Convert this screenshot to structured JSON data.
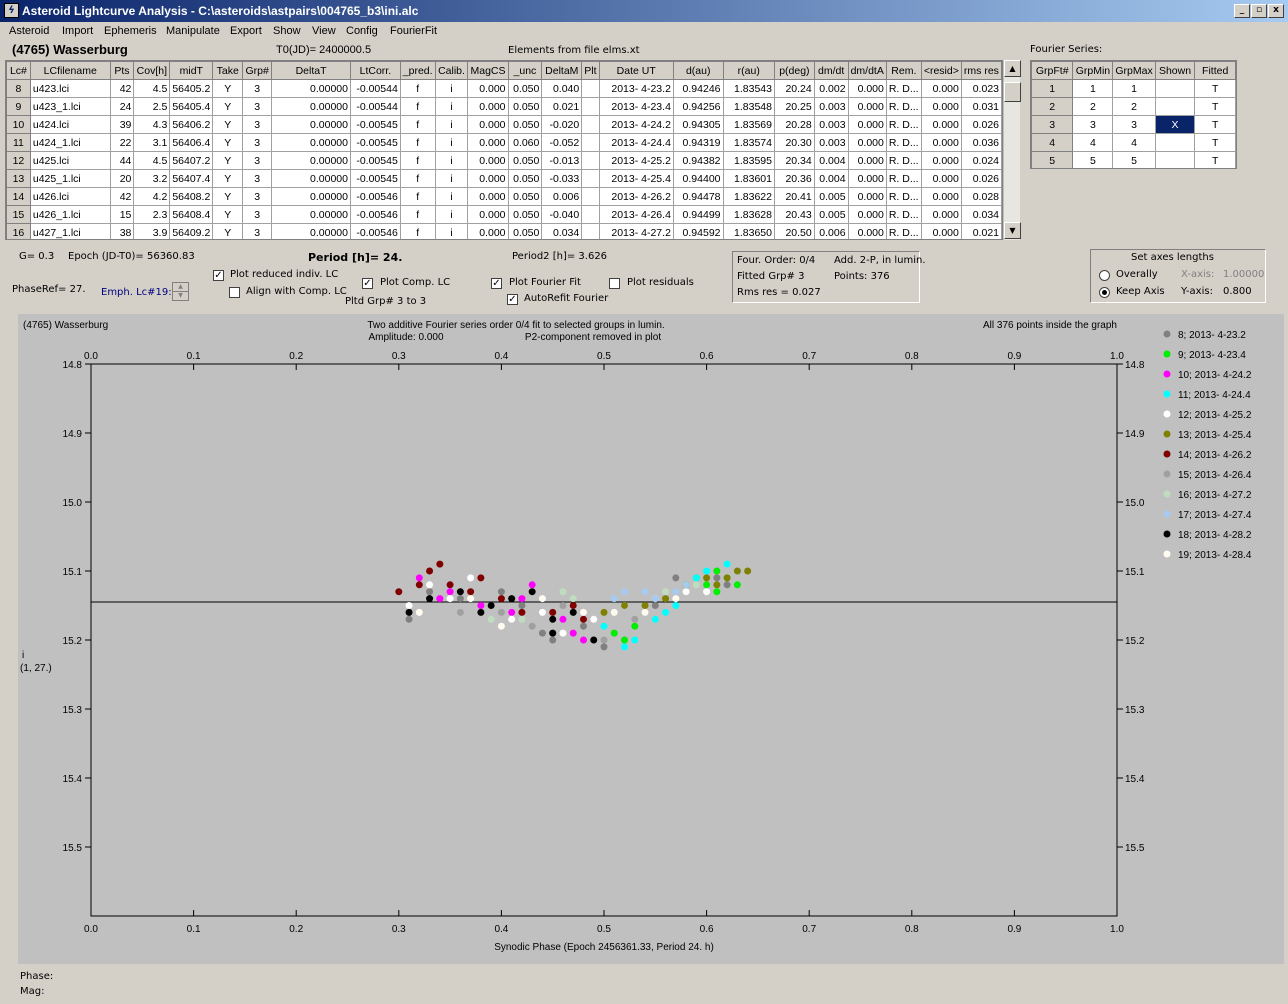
{
  "window": {
    "title": "Asteroid Lightcurve Analysis - C:\\asteroids\\astpairs\\004765_b3\\ini.alc",
    "icon": "app-icon"
  },
  "menu": [
    "Asteroid",
    "Import",
    "Ephemeris",
    "Manipulate",
    "Export",
    "Show",
    "View",
    "Config",
    "FourierFit"
  ],
  "header": {
    "asteroid": "(4765) Wasserburg",
    "t0": "T0(JD)= 2400000.5",
    "elements": "Elements from file elms.xt",
    "fourier_label": "Fourier Series:"
  },
  "lc_table": {
    "columns": [
      "Lc#",
      "LCfilename",
      "Pts",
      "Cov[h]",
      "midT",
      "Take",
      "Grp#",
      "DeltaT",
      "LtCorr.",
      "_pred.",
      "Calib.",
      "MagCS",
      "_unc",
      "DeltaM",
      "Plt",
      "Date UT",
      "d(au)",
      "r(au)",
      "p(deg)",
      "dm/dt",
      "dm/dtA",
      "Rem.",
      "<resid>",
      "rms res"
    ],
    "rows": [
      [
        "8",
        "u423.lci",
        "42",
        "4.5",
        "56405.2",
        "Y",
        "3",
        "0.00000",
        "-0.00544",
        "f",
        "i",
        "0.000",
        "0.050",
        "0.040",
        "",
        "2013- 4-23.2",
        "0.94246",
        "1.83543",
        "20.24",
        "0.002",
        "0.000",
        "R. D...",
        "0.000",
        "0.023"
      ],
      [
        "9",
        "u423_1.lci",
        "24",
        "2.5",
        "56405.4",
        "Y",
        "3",
        "0.00000",
        "-0.00544",
        "f",
        "i",
        "0.000",
        "0.050",
        "0.021",
        "",
        "2013- 4-23.4",
        "0.94256",
        "1.83548",
        "20.25",
        "0.003",
        "0.000",
        "R. D...",
        "0.000",
        "0.031"
      ],
      [
        "10",
        "u424.lci",
        "39",
        "4.3",
        "56406.2",
        "Y",
        "3",
        "0.00000",
        "-0.00545",
        "f",
        "i",
        "0.000",
        "0.050",
        "-0.020",
        "",
        "2013- 4-24.2",
        "0.94305",
        "1.83569",
        "20.28",
        "0.003",
        "0.000",
        "R. D...",
        "0.000",
        "0.026"
      ],
      [
        "11",
        "u424_1.lci",
        "22",
        "3.1",
        "56406.4",
        "Y",
        "3",
        "0.00000",
        "-0.00545",
        "f",
        "i",
        "0.000",
        "0.060",
        "-0.052",
        "",
        "2013- 4-24.4",
        "0.94319",
        "1.83574",
        "20.30",
        "0.003",
        "0.000",
        "R. D...",
        "0.000",
        "0.036"
      ],
      [
        "12",
        "u425.lci",
        "44",
        "4.5",
        "56407.2",
        "Y",
        "3",
        "0.00000",
        "-0.00545",
        "f",
        "i",
        "0.000",
        "0.050",
        "-0.013",
        "",
        "2013- 4-25.2",
        "0.94382",
        "1.83595",
        "20.34",
        "0.004",
        "0.000",
        "R. D...",
        "0.000",
        "0.024"
      ],
      [
        "13",
        "u425_1.lci",
        "20",
        "3.2",
        "56407.4",
        "Y",
        "3",
        "0.00000",
        "-0.00545",
        "f",
        "i",
        "0.000",
        "0.050",
        "-0.033",
        "",
        "2013- 4-25.4",
        "0.94400",
        "1.83601",
        "20.36",
        "0.004",
        "0.000",
        "R. D...",
        "0.000",
        "0.026"
      ],
      [
        "14",
        "u426.lci",
        "42",
        "4.2",
        "56408.2",
        "Y",
        "3",
        "0.00000",
        "-0.00546",
        "f",
        "i",
        "0.000",
        "0.050",
        "0.006",
        "",
        "2013- 4-26.2",
        "0.94478",
        "1.83622",
        "20.41",
        "0.005",
        "0.000",
        "R. D...",
        "0.000",
        "0.028"
      ],
      [
        "15",
        "u426_1.lci",
        "15",
        "2.3",
        "56408.4",
        "Y",
        "3",
        "0.00000",
        "-0.00546",
        "f",
        "i",
        "0.000",
        "0.050",
        "-0.040",
        "",
        "2013- 4-26.4",
        "0.94499",
        "1.83628",
        "20.43",
        "0.005",
        "0.000",
        "R. D...",
        "0.000",
        "0.034"
      ],
      [
        "16",
        "u427_1.lci",
        "38",
        "3.9",
        "56409.2",
        "Y",
        "3",
        "0.00000",
        "-0.00546",
        "f",
        "i",
        "0.000",
        "0.050",
        "0.034",
        "",
        "2013- 4-27.2",
        "0.94592",
        "1.83650",
        "20.50",
        "0.006",
        "0.000",
        "R. D...",
        "0.000",
        "0.021"
      ]
    ]
  },
  "fourier_table": {
    "columns": [
      "GrpFt#",
      "GrpMin",
      "GrpMax",
      "Shown",
      "Fitted"
    ],
    "rows": [
      [
        "1",
        "1",
        "1",
        "",
        "T"
      ],
      [
        "2",
        "2",
        "2",
        "",
        "T"
      ],
      [
        "3",
        "3",
        "3",
        "X",
        "T"
      ],
      [
        "4",
        "4",
        "4",
        "",
        "T"
      ],
      [
        "5",
        "5",
        "5",
        "",
        "T"
      ]
    ]
  },
  "controls": {
    "g": "G= 0.3",
    "epoch": "Epoch (JD-T0)= 56360.83",
    "period": "Period [h]= 24.",
    "period2": "Period2 [h]= 3.626",
    "phaseref": "PhaseRef= 27.",
    "emph": "Emph. Lc#19:",
    "plot_reduced": "Plot reduced indiv. LC",
    "align_comp": "Align with Comp. LC",
    "plot_comp": "Plot Comp. LC",
    "pltd_grp": "Pltd Grp#  3  to   3",
    "plot_fourier": "Plot Fourier Fit",
    "autorefit": "AutoRefit Fourier",
    "plot_residuals": "Plot residuals",
    "info_order": "Four. Order:  0/4",
    "info_fitted": "Fitted Grp# 3",
    "info_rms": "Rms res    = 0.027",
    "info_add": "Add. 2-P, in lumin.",
    "info_points": "Points: 376",
    "axes_title": "Set axes lengths",
    "overally": "Overally",
    "keep_axis": "Keep Axis",
    "xaxis_label": "X-axis:",
    "xaxis_val": "1.00000",
    "yaxis_label": "Y-axis:",
    "yaxis_val": "0.800"
  },
  "status": {
    "phase": "Phase:",
    "mag": "Mag:"
  },
  "chart_data": {
    "type": "scatter",
    "title": "(4765) Wasserburg",
    "subtitle": "Two additive Fourier series order 0/4 fit to selected groups in lumin.",
    "amplitude": "Amplitude: 0.000",
    "p2note": "P2-component removed in plot",
    "note_right": "All 376 points inside the graph",
    "xlabel": "Synodic Phase (Epoch 2456361.33, Period 24. h)",
    "ylabel": "i",
    "ylabel2": "(1, 27.)",
    "xlim": [
      0.0,
      1.0
    ],
    "ylim": [
      14.8,
      15.6
    ],
    "y_inverted": true,
    "fit_line_y": 15.145,
    "x_ticks": [
      "0.0",
      "0.1",
      "0.2",
      "0.3",
      "0.4",
      "0.5",
      "0.6",
      "0.7",
      "0.8",
      "0.9",
      "1.0"
    ],
    "y_ticks": [
      "14.8",
      "14.9",
      "15.0",
      "15.1",
      "15.2",
      "15.3",
      "15.4",
      "15.5"
    ],
    "legend": [
      {
        "label": "8; 2013- 4-23.2",
        "color": "#808080"
      },
      {
        "label": "9; 2013- 4-23.4",
        "color": "#00ee00"
      },
      {
        "label": "10; 2013- 4-24.2",
        "color": "#ff00ff"
      },
      {
        "label": "11; 2013- 4-24.4",
        "color": "#00ffff"
      },
      {
        "label": "12; 2013- 4-25.2",
        "color": "#ffffff"
      },
      {
        "label": "13; 2013- 4-25.4",
        "color": "#808000"
      },
      {
        "label": "14; 2013- 4-26.2",
        "color": "#800000"
      },
      {
        "label": "15; 2013- 4-26.4",
        "color": "#a0a0a0"
      },
      {
        "label": "16; 2013- 4-27.2",
        "color": "#c0dcc0"
      },
      {
        "label": "17; 2013- 4-27.4",
        "color": "#a6caf0"
      },
      {
        "label": "18; 2013- 4-28.2",
        "color": "#000000"
      },
      {
        "label": "19; 2013- 4-28.4",
        "color": "#fffbf0"
      }
    ],
    "series": [
      {
        "color": "#808080",
        "points": [
          [
            0.31,
            15.17
          ],
          [
            0.33,
            15.13
          ],
          [
            0.36,
            15.14
          ],
          [
            0.4,
            15.13
          ],
          [
            0.42,
            15.15
          ],
          [
            0.44,
            15.19
          ],
          [
            0.45,
            15.2
          ],
          [
            0.48,
            15.18
          ],
          [
            0.5,
            15.21
          ],
          [
            0.55,
            15.15
          ],
          [
            0.57,
            15.11
          ],
          [
            0.61,
            15.11
          ],
          [
            0.62,
            15.12
          ]
        ]
      },
      {
        "color": "#00ee00",
        "points": [
          [
            0.51,
            15.19
          ],
          [
            0.52,
            15.2
          ],
          [
            0.53,
            15.18
          ],
          [
            0.58,
            15.12
          ],
          [
            0.59,
            15.11
          ],
          [
            0.6,
            15.12
          ],
          [
            0.61,
            15.13
          ],
          [
            0.62,
            15.11
          ],
          [
            0.63,
            15.12
          ],
          [
            0.61,
            15.1
          ]
        ]
      },
      {
        "color": "#ff00ff",
        "points": [
          [
            0.32,
            15.11
          ],
          [
            0.34,
            15.14
          ],
          [
            0.38,
            15.15
          ],
          [
            0.41,
            15.16
          ],
          [
            0.42,
            15.14
          ],
          [
            0.43,
            15.12
          ],
          [
            0.46,
            15.17
          ],
          [
            0.47,
            15.19
          ],
          [
            0.48,
            15.2
          ],
          [
            0.35,
            15.13
          ]
        ]
      },
      {
        "color": "#00ffff",
        "points": [
          [
            0.5,
            15.18
          ],
          [
            0.52,
            15.21
          ],
          [
            0.53,
            15.2
          ],
          [
            0.55,
            15.17
          ],
          [
            0.57,
            15.15
          ],
          [
            0.59,
            15.11
          ],
          [
            0.6,
            15.1
          ],
          [
            0.62,
            15.09
          ],
          [
            0.63,
            15.1
          ],
          [
            0.56,
            15.16
          ]
        ]
      },
      {
        "color": "#ffffff",
        "points": [
          [
            0.31,
            15.15
          ],
          [
            0.33,
            15.12
          ],
          [
            0.35,
            15.14
          ],
          [
            0.37,
            15.11
          ],
          [
            0.39,
            15.15
          ],
          [
            0.41,
            15.17
          ],
          [
            0.44,
            15.16
          ],
          [
            0.46,
            15.19
          ],
          [
            0.49,
            15.17
          ],
          [
            0.52,
            15.15
          ],
          [
            0.55,
            15.14
          ],
          [
            0.58,
            15.13
          ],
          [
            0.6,
            15.13
          ]
        ]
      },
      {
        "color": "#808000",
        "points": [
          [
            0.5,
            15.16
          ],
          [
            0.52,
            15.15
          ],
          [
            0.54,
            15.15
          ],
          [
            0.56,
            15.14
          ],
          [
            0.58,
            15.12
          ],
          [
            0.6,
            15.11
          ],
          [
            0.62,
            15.11
          ],
          [
            0.63,
            15.1
          ],
          [
            0.64,
            15.1
          ],
          [
            0.61,
            15.12
          ]
        ]
      },
      {
        "color": "#800000",
        "points": [
          [
            0.3,
            15.13
          ],
          [
            0.32,
            15.12
          ],
          [
            0.33,
            15.1
          ],
          [
            0.34,
            15.09
          ],
          [
            0.35,
            15.12
          ],
          [
            0.37,
            15.13
          ],
          [
            0.38,
            15.11
          ],
          [
            0.4,
            15.14
          ],
          [
            0.42,
            15.16
          ],
          [
            0.45,
            15.16
          ],
          [
            0.47,
            15.15
          ],
          [
            0.48,
            15.17
          ]
        ]
      },
      {
        "color": "#a0a0a0",
        "points": [
          [
            0.36,
            15.16
          ],
          [
            0.4,
            15.16
          ],
          [
            0.43,
            15.18
          ],
          [
            0.46,
            15.15
          ],
          [
            0.5,
            15.2
          ],
          [
            0.53,
            15.17
          ]
        ]
      },
      {
        "color": "#c0dcc0",
        "points": [
          [
            0.39,
            15.17
          ],
          [
            0.42,
            15.17
          ],
          [
            0.46,
            15.13
          ],
          [
            0.47,
            15.14
          ],
          [
            0.56,
            15.13
          ],
          [
            0.59,
            15.12
          ]
        ]
      },
      {
        "color": "#a6caf0",
        "points": [
          [
            0.51,
            15.14
          ],
          [
            0.52,
            15.13
          ],
          [
            0.54,
            15.13
          ],
          [
            0.55,
            15.14
          ],
          [
            0.57,
            15.13
          ],
          [
            0.58,
            15.12
          ]
        ]
      },
      {
        "color": "#000000",
        "points": [
          [
            0.31,
            15.16
          ],
          [
            0.33,
            15.14
          ],
          [
            0.36,
            15.13
          ],
          [
            0.38,
            15.16
          ],
          [
            0.39,
            15.15
          ],
          [
            0.41,
            15.14
          ],
          [
            0.43,
            15.13
          ],
          [
            0.45,
            15.19
          ],
          [
            0.47,
            15.16
          ],
          [
            0.49,
            15.2
          ],
          [
            0.45,
            15.17
          ]
        ]
      },
      {
        "color": "#fffbf0",
        "points": [
          [
            0.32,
            15.16
          ],
          [
            0.37,
            15.14
          ],
          [
            0.4,
            15.18
          ],
          [
            0.44,
            15.14
          ],
          [
            0.48,
            15.16
          ],
          [
            0.51,
            15.16
          ],
          [
            0.54,
            15.16
          ],
          [
            0.57,
            15.14
          ]
        ]
      }
    ]
  }
}
